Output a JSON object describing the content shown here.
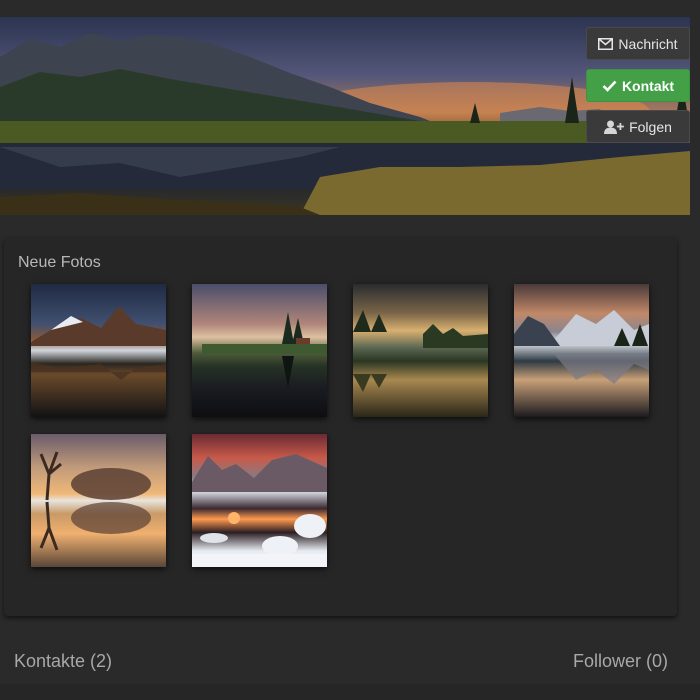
{
  "header": {
    "buttons": {
      "message_label": "Nachricht",
      "contact_label": "Kontakt",
      "follow_label": "Folgen"
    },
    "colors": {
      "contact_accent": "#43a047",
      "button_dark": "#3a3a3a"
    },
    "icons": {
      "message": "envelope-icon",
      "contact": "check-icon",
      "follow": "user-plus-icon"
    }
  },
  "photos_section": {
    "title": "Neue Fotos",
    "photos": [
      {
        "subject": "mountain-lake-reflection-mist"
      },
      {
        "subject": "cabin-by-lake-foggy-sunrise"
      },
      {
        "subject": "golden-sunset-forest-lake"
      },
      {
        "subject": "snowy-peaks-lake-sunset"
      },
      {
        "subject": "trees-reflected-golden-mist"
      },
      {
        "subject": "winter-lake-sunset-snow"
      }
    ]
  },
  "footer": {
    "contacts_label": "Kontakte (2)",
    "followers_label": "Follower (0)"
  }
}
